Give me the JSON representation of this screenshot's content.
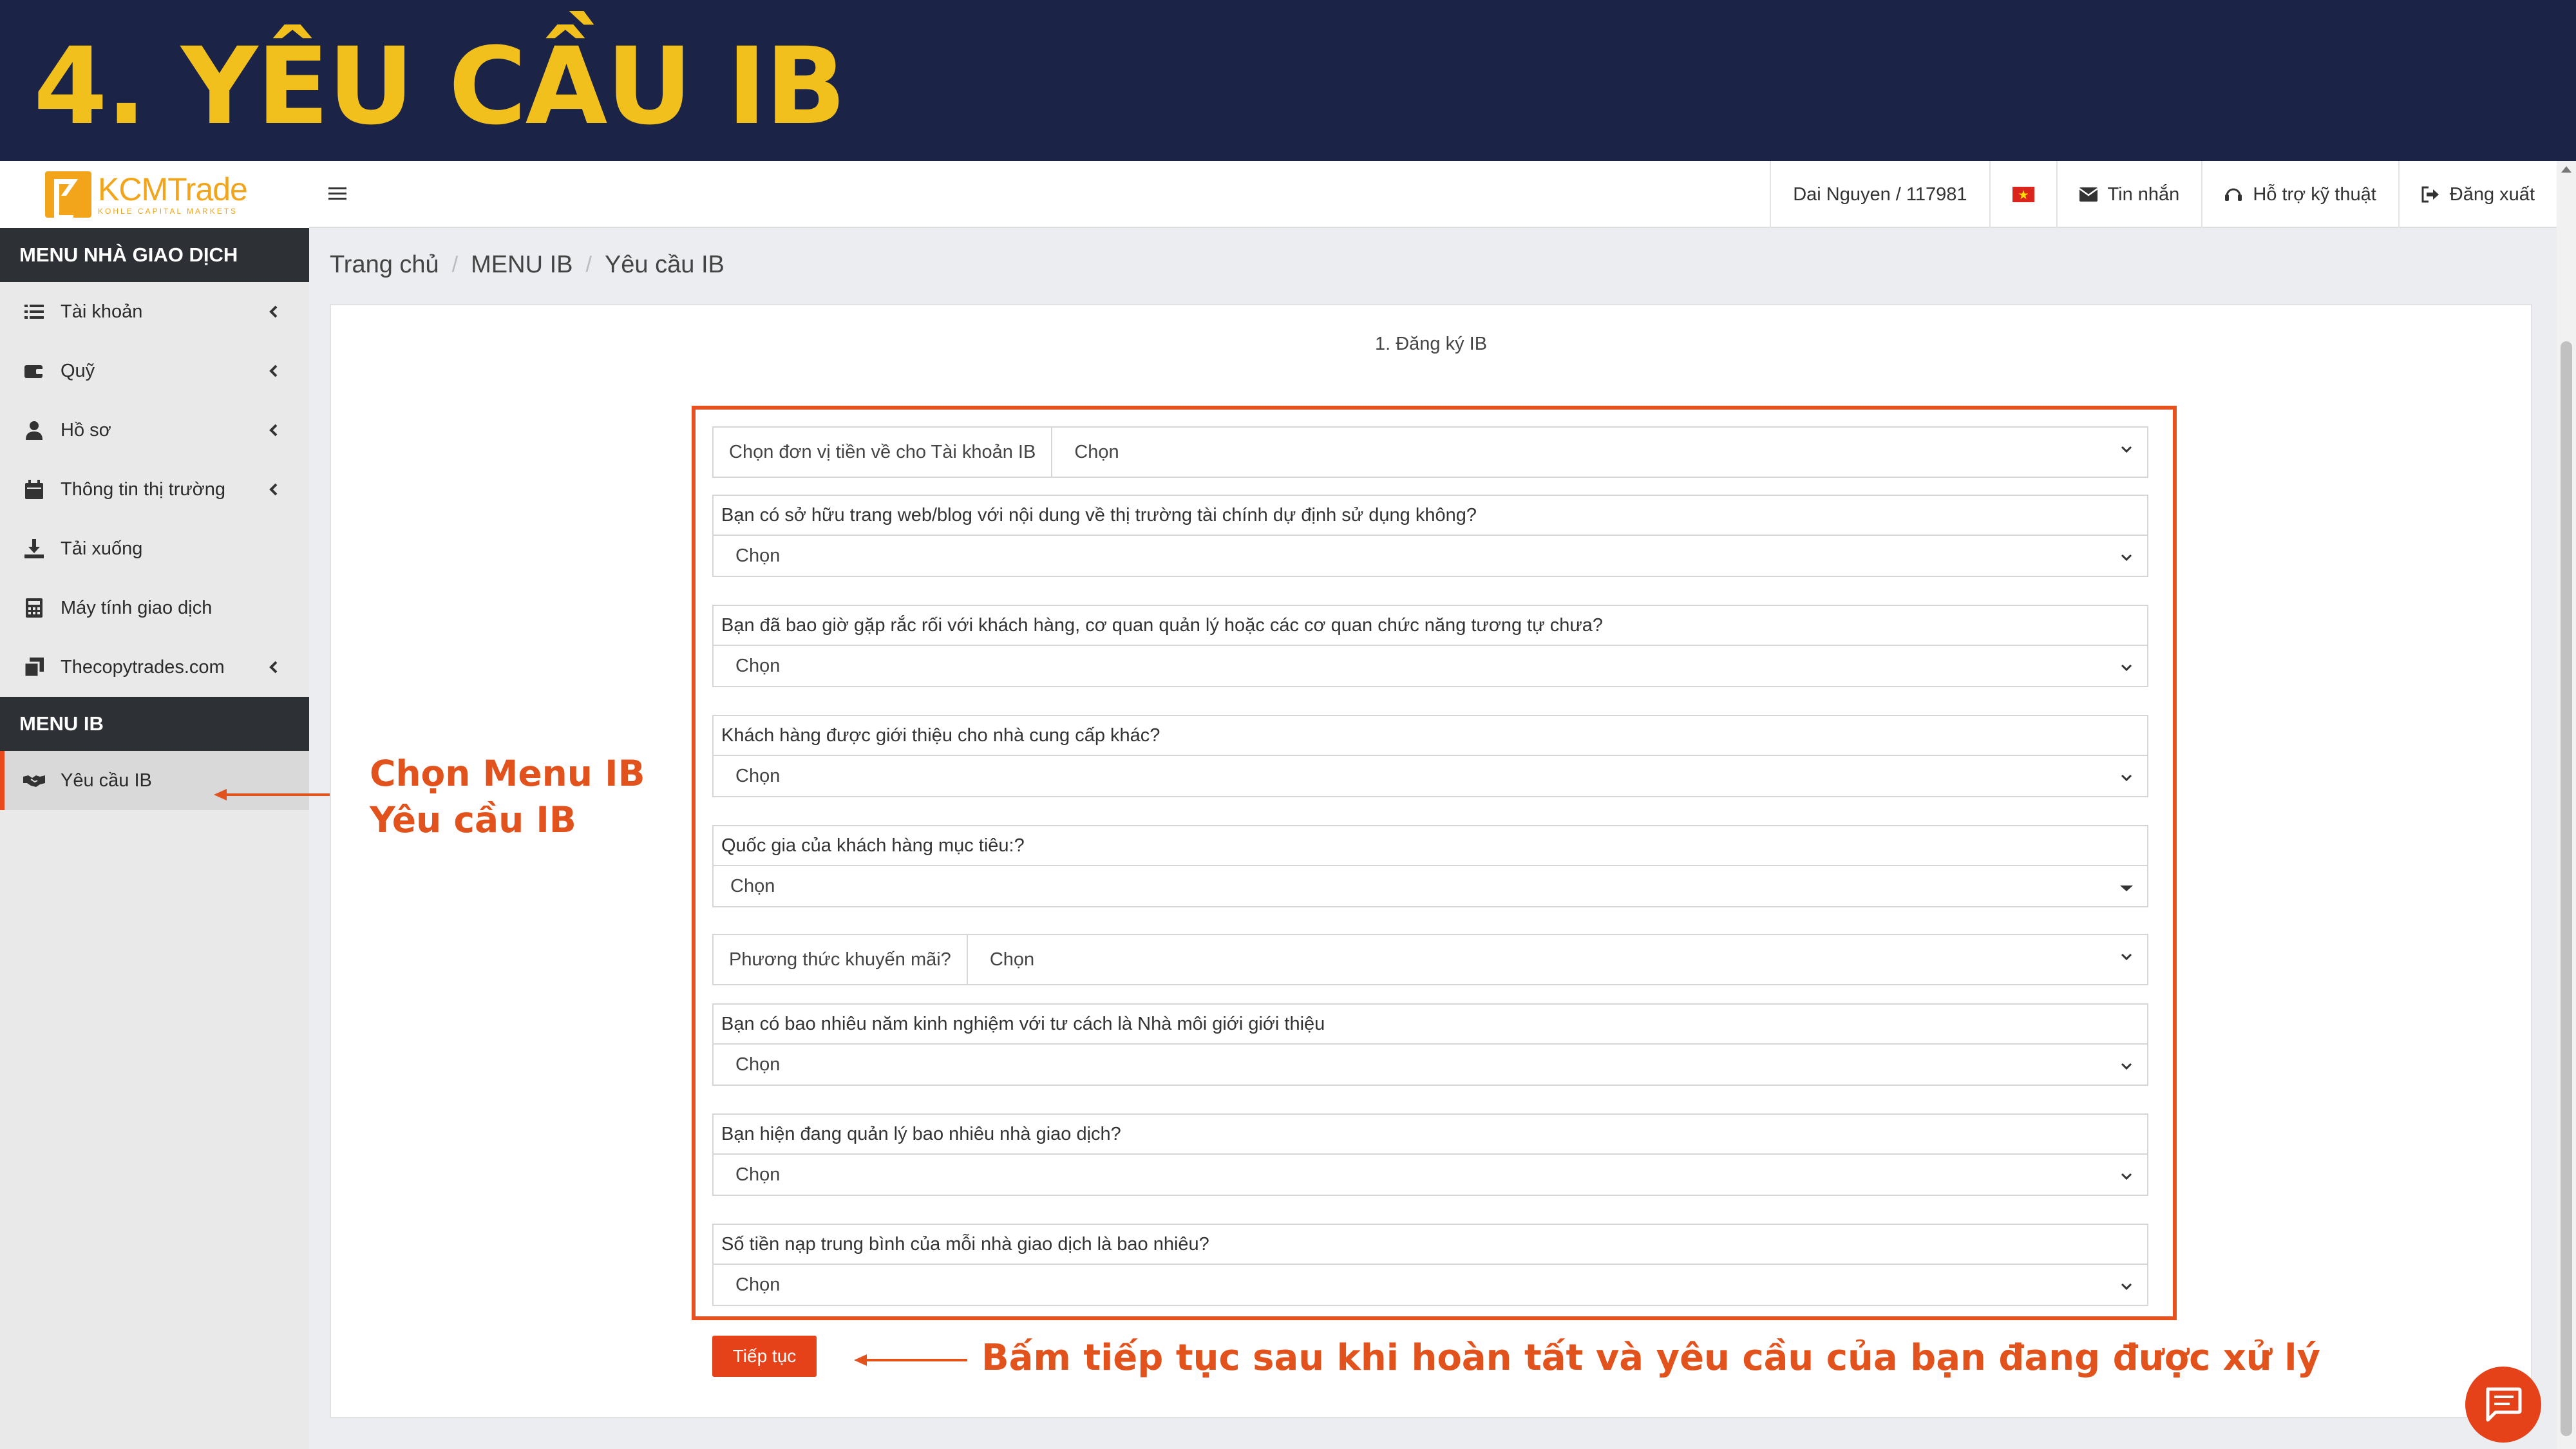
{
  "banner": {
    "title": "4. YÊU CẦU IB"
  },
  "logo": {
    "name": "KCMTrade",
    "tagline": "KOHLE CAPITAL MARKETS"
  },
  "sidebar": {
    "trader_menu_header": "MENU NHÀ GIAO DỊCH",
    "items": [
      {
        "label": "Tài khoản",
        "icon": "list-icon"
      },
      {
        "label": "Quỹ",
        "icon": "wallet-icon"
      },
      {
        "label": "Hồ sơ",
        "icon": "user-icon"
      },
      {
        "label": "Thông tin thị trường",
        "icon": "calendar-icon"
      },
      {
        "label": "Tải xuống",
        "icon": "download-icon"
      },
      {
        "label": "Máy tính giao dịch",
        "icon": "calculator-icon"
      },
      {
        "label": "Thecopytrades.com",
        "icon": "copy-icon"
      }
    ],
    "ib_menu_header": "MENU IB",
    "ib_items": [
      {
        "label": "Yêu cầu IB",
        "icon": "handshake-icon"
      }
    ]
  },
  "topbar": {
    "user": "Dai Nguyen / 117981",
    "messages": "Tin nhắn",
    "support": "Hỗ trợ kỹ thuật",
    "logout": "Đăng xuất"
  },
  "breadcrumb": [
    "Trang chủ",
    "MENU IB",
    "Yêu cầu IB"
  ],
  "form": {
    "step_title": "1. Đăng ký IB",
    "currency_label": "Chọn đơn vị tiền về cho Tài khoản IB",
    "currency_value": "Chọn",
    "questions": [
      {
        "label": "Bạn có sở hữu trang web/blog với nội dung về thị trường tài chính dự định sử dụng không?",
        "value": "Chọn"
      },
      {
        "label": "Bạn đã bao giờ gặp rắc rối với khách hàng, cơ quan quản lý hoặc các cơ quan chức năng tương tự chưa?",
        "value": "Chọn"
      },
      {
        "label": "Khách hàng được giới thiệu cho nhà cung cấp khác?",
        "value": "Chọn"
      },
      {
        "label": "Quốc gia của khách hàng mục tiêu:?",
        "value": "Chọn"
      }
    ],
    "promo_label": "Phương thức khuyến mãi?",
    "promo_value": "Chọn",
    "questions2": [
      {
        "label": "Bạn có bao nhiêu năm kinh nghiệm với tư cách là Nhà môi giới giới thiệu",
        "value": "Chọn"
      },
      {
        "label": "Bạn hiện đang quản lý bao nhiêu nhà giao dịch?",
        "value": "Chọn"
      },
      {
        "label": "Số tiền nạp trung bình của mỗi nhà giao dịch là bao nhiêu?",
        "value": "Chọn"
      }
    ],
    "continue_label": "Tiếp tục"
  },
  "annotations": {
    "menu_line1": "Chọn Menu IB",
    "menu_line2": "Yêu cầu IB",
    "continue_note": "Bấm tiếp tục sau khi hoàn tất và yêu cầu của bạn đang được xử lý"
  },
  "colors": {
    "banner_bg": "#1b2447",
    "banner_text": "#f2c01c",
    "accent": "#e5421a",
    "brand": "#f2a51a"
  }
}
